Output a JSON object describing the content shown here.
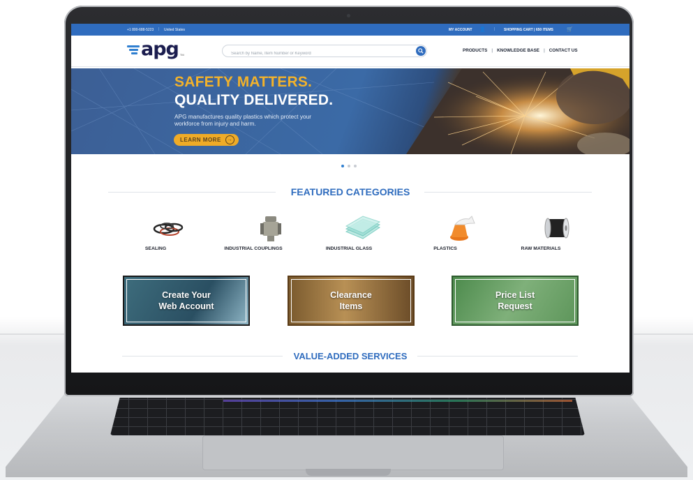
{
  "topbar": {
    "phone": "+1 800-688-5223",
    "country": "United States",
    "my_account": "MY ACCOUNT",
    "cart": "SHOPPING CART | 650 ITEMS"
  },
  "header": {
    "logo_text": "apg",
    "logo_tm": "TM",
    "search_placeholder": "Search by Name, Item Number or Keyword",
    "nav": [
      "PRODUCTS",
      "KNOWLEDGE BASE",
      "CONTACT US"
    ]
  },
  "hero": {
    "headline_1": "SAFETY MATTERS.",
    "headline_2": "QUALITY DELIVERED.",
    "body": "APG manufactures quality plastics which protect your workforce from injury and harm.",
    "cta": "LEARN MORE",
    "slides_total": 3,
    "active_slide": 1
  },
  "featured": {
    "title": "FEATURED CATEGORIES",
    "categories": [
      "SEALING",
      "INDUSTRIAL COUPLINGS",
      "INDUSTRIAL GLASS",
      "PLASTICS",
      "RAW MATERIALS"
    ]
  },
  "promos": [
    {
      "label_1": "Create Your",
      "label_2": "Web Account"
    },
    {
      "label_1": "Clearance",
      "label_2": "Items"
    },
    {
      "label_1": "Price List",
      "label_2": "Request"
    }
  ],
  "services": {
    "title": "VALUE-ADDED SERVICES"
  },
  "colors": {
    "brand_blue": "#2f6cbe",
    "accent_yellow": "#efab27",
    "navy": "#1b1d4f"
  }
}
